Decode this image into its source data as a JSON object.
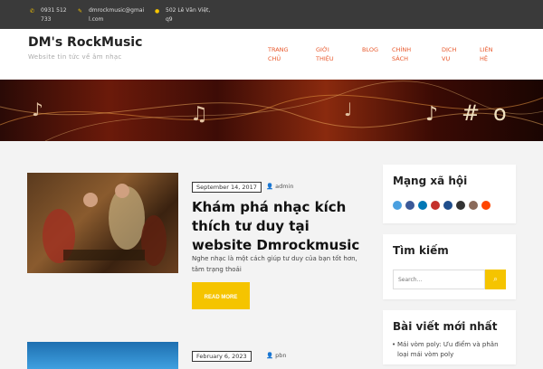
{
  "topbar": {
    "phone": "0931 512 733",
    "email": "dmrockmusic@gmail.com",
    "address": "502 Lê Văn Việt, q9"
  },
  "site": {
    "title": "DM's RockMusic",
    "tagline": "Website tin tức về âm nhạc"
  },
  "nav": {
    "items": [
      {
        "label": "TRANG CHỦ"
      },
      {
        "label": "GIỚI THIỆU"
      },
      {
        "label": "BLOG"
      },
      {
        "label": "CHÍNH SÁCH"
      },
      {
        "label": "DỊCH VỤ"
      },
      {
        "label": "LIÊN HỆ"
      }
    ]
  },
  "posts": [
    {
      "date": "September 14, 2017",
      "author": "admin",
      "title": "Khám phá nhạc kích thích tư duy tại website Dmrockmusic",
      "excerpt": "Nghe nhạc là một cách giúp tư duy của bạn tốt hơn, tâm trạng thoải",
      "read_more": "READ MORE"
    },
    {
      "date": "February 6, 2023",
      "author": "pbn"
    }
  ],
  "sidebar": {
    "social_title": "Mạng xã hội",
    "search_title": "Tìm kiếm",
    "search_placeholder": "Search...",
    "recent_title": "Bài viết mới nhất",
    "recent_items": [
      "Mái vòm poly: Ưu điểm và phân loại mái vòm poly"
    ]
  },
  "colors": {
    "accent": "#f5c400",
    "nav": "#e8572a",
    "topbar": "#3a3a3a"
  }
}
